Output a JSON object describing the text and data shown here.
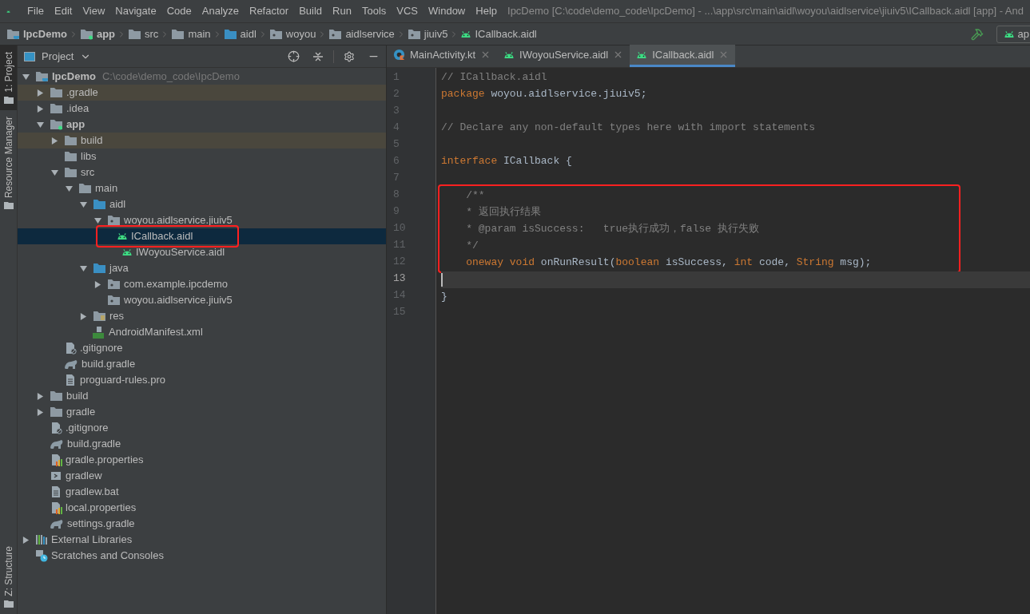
{
  "menu": [
    "File",
    "Edit",
    "View",
    "Navigate",
    "Code",
    "Analyze",
    "Refactor",
    "Build",
    "Run",
    "Tools",
    "VCS",
    "Window",
    "Help"
  ],
  "window": {
    "title": "IpcDemo [C:\\code\\demo_code\\IpcDemo] - ...\\app\\src\\main\\aidl\\woyou\\aidlservice\\jiuiv5\\ICallback.aidl [app] - And"
  },
  "breadcrumbs": [
    {
      "label": "IpcDemo",
      "kind": "project",
      "bold": true
    },
    {
      "label": "app",
      "kind": "module",
      "bold": true
    },
    {
      "label": "src",
      "kind": "folder",
      "bold": false
    },
    {
      "label": "main",
      "kind": "folder",
      "bold": false
    },
    {
      "label": "aidl",
      "kind": "source",
      "bold": false
    },
    {
      "label": "woyou",
      "kind": "package",
      "bold": false
    },
    {
      "label": "aidlservice",
      "kind": "package",
      "bold": false
    },
    {
      "label": "jiuiv5",
      "kind": "package",
      "bold": false
    },
    {
      "label": "ICallback.aidl",
      "kind": "android",
      "bold": false
    }
  ],
  "run_config": {
    "label": "ap"
  },
  "tool_strip": {
    "top": [
      {
        "label": "1: Project",
        "selected": true
      },
      {
        "label": "Resource Manager",
        "selected": false
      }
    ],
    "bottom": [
      {
        "label": "Z: Structure",
        "selected": false
      }
    ]
  },
  "project_panel": {
    "title": "Project",
    "tree": [
      {
        "label": "IpcDemo",
        "kind": "project",
        "bold": true,
        "hint": "C:\\code\\demo_code\\IpcDemo",
        "expanded": true,
        "excluded": false,
        "selected": false,
        "annotated": false,
        "children": [
          {
            "label": ".gradle",
            "kind": "folder",
            "bold": false,
            "expanded": false,
            "excluded": true,
            "selected": false,
            "annotated": false
          },
          {
            "label": ".idea",
            "kind": "folder",
            "bold": false,
            "expanded": false,
            "excluded": false,
            "selected": false,
            "annotated": false
          },
          {
            "label": "app",
            "kind": "module",
            "bold": true,
            "expanded": true,
            "excluded": false,
            "selected": false,
            "annotated": false,
            "children": [
              {
                "label": "build",
                "kind": "folder",
                "bold": false,
                "expanded": false,
                "excluded": true,
                "selected": false,
                "annotated": false
              },
              {
                "label": "libs",
                "kind": "folder",
                "bold": false,
                "excluded": false,
                "selected": false,
                "annotated": false
              },
              {
                "label": "src",
                "kind": "folder",
                "bold": false,
                "expanded": true,
                "excluded": false,
                "selected": false,
                "annotated": false,
                "children": [
                  {
                    "label": "main",
                    "kind": "folder",
                    "bold": false,
                    "expanded": true,
                    "excluded": false,
                    "selected": false,
                    "annotated": false,
                    "children": [
                      {
                        "label": "aidl",
                        "kind": "source",
                        "bold": false,
                        "expanded": true,
                        "excluded": false,
                        "selected": false,
                        "annotated": false,
                        "children": [
                          {
                            "label": "woyou.aidlservice.jiuiv5",
                            "kind": "package",
                            "bold": false,
                            "expanded": true,
                            "excluded": false,
                            "selected": false,
                            "annotated": false,
                            "children": [
                              {
                                "label": "ICallback.aidl",
                                "kind": "android",
                                "bold": false,
                                "excluded": false,
                                "selected": true,
                                "annotated": true
                              },
                              {
                                "label": "IWoyouService.aidl",
                                "kind": "android",
                                "bold": false,
                                "excluded": false,
                                "selected": false,
                                "annotated": false
                              }
                            ]
                          }
                        ]
                      },
                      {
                        "label": "java",
                        "kind": "source",
                        "bold": false,
                        "expanded": true,
                        "excluded": false,
                        "selected": false,
                        "annotated": false,
                        "children": [
                          {
                            "label": "com.example.ipcdemo",
                            "kind": "package",
                            "bold": false,
                            "expanded": false,
                            "excluded": false,
                            "selected": false,
                            "annotated": false
                          },
                          {
                            "label": "woyou.aidlservice.jiuiv5",
                            "kind": "package",
                            "bold": false,
                            "excluded": false,
                            "selected": false,
                            "annotated": false
                          }
                        ]
                      },
                      {
                        "label": "res",
                        "kind": "res",
                        "bold": false,
                        "expanded": false,
                        "excluded": false,
                        "selected": false,
                        "annotated": false
                      },
                      {
                        "label": "AndroidManifest.xml",
                        "kind": "manifest",
                        "bold": false,
                        "excluded": false,
                        "selected": false,
                        "annotated": false
                      }
                    ]
                  }
                ]
              },
              {
                "label": ".gitignore",
                "kind": "gitignore",
                "bold": false,
                "excluded": false,
                "selected": false,
                "annotated": false
              },
              {
                "label": "build.gradle",
                "kind": "gradle",
                "bold": false,
                "excluded": false,
                "selected": false,
                "annotated": false
              },
              {
                "label": "proguard-rules.pro",
                "kind": "text",
                "bold": false,
                "excluded": false,
                "selected": false,
                "annotated": false
              }
            ]
          },
          {
            "label": "build",
            "kind": "folder",
            "bold": false,
            "expanded": false,
            "excluded": false,
            "selected": false,
            "annotated": false
          },
          {
            "label": "gradle",
            "kind": "folder",
            "bold": false,
            "expanded": false,
            "excluded": false,
            "selected": false,
            "annotated": false
          },
          {
            "label": ".gitignore",
            "kind": "gitignore",
            "bold": false,
            "excluded": false,
            "selected": false,
            "annotated": false
          },
          {
            "label": "build.gradle",
            "kind": "gradle",
            "bold": false,
            "excluded": false,
            "selected": false,
            "annotated": false
          },
          {
            "label": "gradle.properties",
            "kind": "properties",
            "bold": false,
            "excluded": false,
            "selected": false,
            "annotated": false
          },
          {
            "label": "gradlew",
            "kind": "script",
            "bold": false,
            "excluded": false,
            "selected": false,
            "annotated": false
          },
          {
            "label": "gradlew.bat",
            "kind": "text",
            "bold": false,
            "excluded": false,
            "selected": false,
            "annotated": false
          },
          {
            "label": "local.properties",
            "kind": "properties",
            "bold": false,
            "excluded": false,
            "selected": false,
            "annotated": false
          },
          {
            "label": "settings.gradle",
            "kind": "gradle",
            "bold": false,
            "excluded": false,
            "selected": false,
            "annotated": false
          }
        ]
      },
      {
        "label": "External Libraries",
        "kind": "libraries",
        "bold": false,
        "expanded": false,
        "excluded": false,
        "selected": false,
        "annotated": false
      },
      {
        "label": "Scratches and Consoles",
        "kind": "scratches",
        "bold": false,
        "excluded": false,
        "selected": false,
        "annotated": false
      }
    ]
  },
  "editor_tabs": [
    {
      "label": "MainActivity.kt",
      "kind": "kotlin",
      "selected": false
    },
    {
      "label": "IWoyouService.aidl",
      "kind": "android",
      "selected": false
    },
    {
      "label": "ICallback.aidl",
      "kind": "android",
      "selected": true
    }
  ],
  "code_lines": [
    {
      "number": "1",
      "current": false,
      "boxed": false,
      "tokens": [
        {
          "kind": "comment",
          "text": "// ICallback.aidl"
        }
      ]
    },
    {
      "number": "2",
      "current": false,
      "boxed": false,
      "tokens": [
        {
          "kind": "keyword",
          "text": "package "
        },
        {
          "kind": "plain",
          "text": "woyou.aidlservice.jiuiv5;"
        }
      ]
    },
    {
      "number": "3",
      "current": false,
      "boxed": false
    },
    {
      "number": "4",
      "current": false,
      "boxed": false,
      "tokens": [
        {
          "kind": "comment",
          "text": "// Declare any non-default types here with import statements"
        }
      ]
    },
    {
      "number": "5",
      "current": false,
      "boxed": false
    },
    {
      "number": "6",
      "current": false,
      "boxed": false,
      "tokens": [
        {
          "kind": "keyword",
          "text": "interface "
        },
        {
          "kind": "plain",
          "text": "ICallback {"
        }
      ]
    },
    {
      "number": "7",
      "current": false,
      "boxed": false
    },
    {
      "number": "8",
      "current": false,
      "boxed": true,
      "tokens": [
        {
          "kind": "comment",
          "text": "    /**"
        }
      ]
    },
    {
      "number": "9",
      "current": false,
      "boxed": true,
      "tokens": [
        {
          "kind": "comment",
          "text": "    * 返回执行结果"
        }
      ]
    },
    {
      "number": "10",
      "current": false,
      "boxed": true,
      "tokens": [
        {
          "kind": "comment",
          "text": "    * @param isSuccess:   true执行成功，false 执行失败"
        }
      ]
    },
    {
      "number": "11",
      "current": false,
      "boxed": true,
      "tokens": [
        {
          "kind": "comment",
          "text": "    */"
        }
      ]
    },
    {
      "number": "12",
      "current": false,
      "boxed": true,
      "tokens": [
        {
          "kind": "keyword",
          "text": "    oneway void "
        },
        {
          "kind": "plain",
          "text": "onRunResult("
        },
        {
          "kind": "keyword",
          "text": "boolean "
        },
        {
          "kind": "plain",
          "text": "isSuccess, "
        },
        {
          "kind": "keyword",
          "text": "int "
        },
        {
          "kind": "plain",
          "text": "code, "
        },
        {
          "kind": "keyword",
          "text": "String "
        },
        {
          "kind": "plain",
          "text": "msg);"
        }
      ]
    },
    {
      "number": "13",
      "current": true,
      "boxed": false
    },
    {
      "number": "14",
      "current": false,
      "boxed": false,
      "tokens": [
        {
          "kind": "plain",
          "text": "}"
        }
      ]
    },
    {
      "number": "15",
      "current": false,
      "boxed": false
    }
  ]
}
